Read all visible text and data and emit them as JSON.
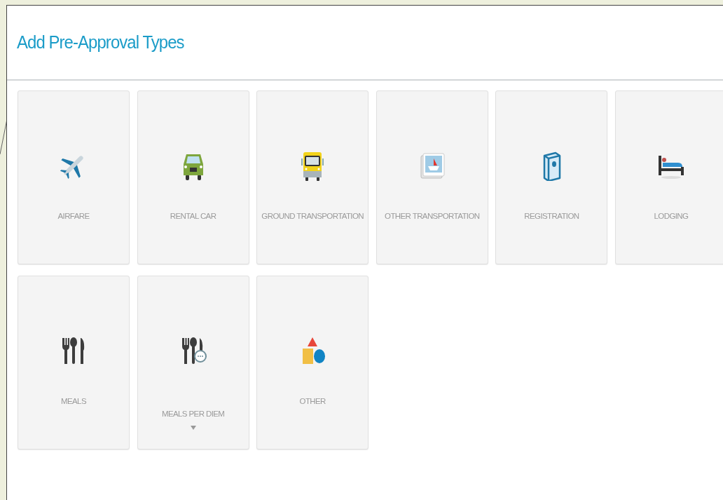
{
  "panel": {
    "title": "Add Pre-Approval Types"
  },
  "tiles": [
    {
      "kind": "airfare",
      "label": "AIRFARE",
      "has_menu": false
    },
    {
      "kind": "rental_car",
      "label": "RENTAL CAR",
      "has_menu": false
    },
    {
      "kind": "ground",
      "label": "GROUND TRANSPORTATION",
      "has_menu": false
    },
    {
      "kind": "other_transport",
      "label": "OTHER TRANSPORTATION",
      "has_menu": false
    },
    {
      "kind": "registration",
      "label": "REGISTRATION",
      "has_menu": false
    },
    {
      "kind": "lodging",
      "label": "LODGING",
      "has_menu": false
    },
    {
      "kind": "meals",
      "label": "MEALS",
      "has_menu": false
    },
    {
      "kind": "meals_per_diem",
      "label": "MEALS PER DIEM",
      "has_menu": true
    },
    {
      "kind": "other",
      "label": "OTHER",
      "has_menu": false
    }
  ]
}
